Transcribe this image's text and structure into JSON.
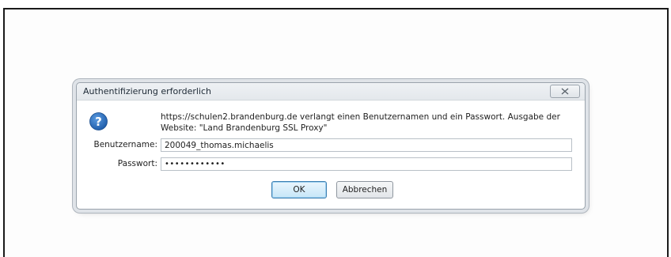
{
  "dialog": {
    "title": "Authentifizierung erforderlich",
    "close_icon": "close-icon",
    "message_icon": "question-icon",
    "message_line1": "https://schulen2.brandenburg.de verlangt einen Benutzernamen und ein Passwort. Ausgabe der",
    "message_line2": "Website: \"Land Brandenburg SSL Proxy\"",
    "username_label": "Benutzername:",
    "username_value": "200049_thomas.michaelis",
    "password_label": "Passwort:",
    "password_value": "••••••••••••",
    "ok_label": "OK",
    "cancel_label": "Abbrechen"
  },
  "colors": {
    "accent_blue": "#2a6db4",
    "ok_border": "#3c7fb1"
  }
}
